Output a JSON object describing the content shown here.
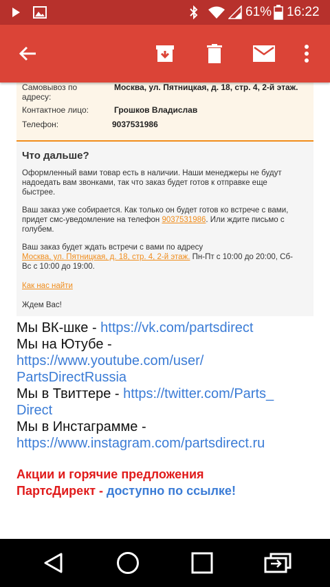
{
  "status_bar": {
    "battery_percent": "61%",
    "time": "16:22",
    "icons": [
      "play-icon",
      "image-icon",
      "bluetooth-icon",
      "wifi-icon",
      "signal-icon",
      "battery-icon"
    ]
  },
  "app_bar": {
    "icons": [
      "back-arrow-icon",
      "archive-icon",
      "delete-icon",
      "mail-icon",
      "more-vert-icon"
    ]
  },
  "order_details": {
    "pickup_label_line1": "Самовывоз по",
    "pickup_label_line2": "адресу:",
    "pickup_value": "Москва, ул. Пятницкая, д. 18, стр. 4, 2-й этаж.",
    "contact_label": "Контактное лицо:",
    "contact_value": "Грошков Владислав",
    "phone_label": "Телефон:",
    "phone_value": "9037531986"
  },
  "next_steps": {
    "title": "Что дальше?",
    "p1_line1": "Оформленный вами товар есть в наличии. Наши менеджеры не будут",
    "p1_line2": "надоедать вам звонками, так что заказ будет готов к отправке еще",
    "p1_line3": "быстрее.",
    "p2_line1": "Ваш заказ уже собирается. Как только он будет готов ко встрече с вами,",
    "p2_line2_pre": "придет смс-уведомление на телефон ",
    "p2_phone_link": "9037531986",
    "p2_line2_post": ". Или ждите письмо с",
    "p2_line3": "голубем.",
    "p3_line1": "Ваш заказ будет ждать встречи с вами по адресу",
    "p3_address_link": "Москва, ул. Пятницкая, д. 18, стр. 4, 2-й этаж.",
    "p3_line2_post": " Пн-Пт с 10:00 до 20:00, Сб-",
    "p3_line3": "Вс с 10:00 до 19:00.",
    "find_us_link": "Как нас найти",
    "closing": "Ждем Вас!"
  },
  "social": {
    "vk_label": "Мы ВК-шке - ",
    "vk_url": "https://vk.com/partsdirect",
    "yt_label": "Мы на Ютубе -",
    "yt_url_line1": "https://www.youtube.com/user/",
    "yt_url_line2": "PartsDirectRussia",
    "tw_label": "Мы в Твиттере - ",
    "tw_url_line1": "https://twitter.com/Parts_",
    "tw_url_line2": "Direct",
    "ig_label": "Мы в Инстаграмме -",
    "ig_url": "https://www.instagram.com/partsdirect.ru"
  },
  "promo": {
    "line1": "Акции и горячие предложения",
    "line2_red": "ПартсДирект - ",
    "line2_blue": "доступно по ссылке!"
  },
  "nav_bar": {
    "icons": [
      "nav-back-icon",
      "nav-home-icon",
      "nav-recents-icon",
      "nav-switch-icon"
    ]
  },
  "colors": {
    "status_bar": "#b7312c",
    "app_bar": "#db4437",
    "accent_orange": "#f08c1a",
    "link_blue": "#3b7cd6",
    "promo_red": "#e01b1b"
  }
}
